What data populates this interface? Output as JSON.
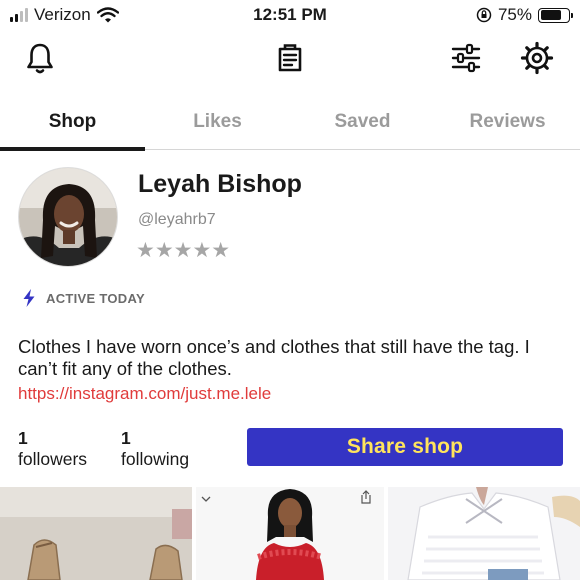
{
  "status_bar": {
    "carrier": "Verizon",
    "time": "12:51 PM",
    "battery": "75%"
  },
  "top_icons": [
    "bell-icon",
    "clipboard-list-icon",
    "sliders-icon",
    "gear-icon"
  ],
  "tabs": [
    {
      "label": "Shop",
      "active": true
    },
    {
      "label": "Likes",
      "active": false
    },
    {
      "label": "Saved",
      "active": false
    },
    {
      "label": "Reviews",
      "active": false
    }
  ],
  "profile": {
    "name": "Leyah Bishop",
    "handle": "@leyahrb7",
    "stars": "★★★★★",
    "active_label": "ACTIVE TODAY",
    "bio": "Clothes I have worn once’s and clothes that still have the tag. I can’t fit any of the clothes.",
    "link": "https://instagram.com/just.me.lele"
  },
  "stats": {
    "followers_count": "1",
    "followers_label": "followers",
    "following_count": "1",
    "following_label": "following"
  },
  "share_button": "Share shop",
  "colors": {
    "accent_button": "#3434c4",
    "button_text": "#ffe45c",
    "link": "#e03b3b"
  }
}
